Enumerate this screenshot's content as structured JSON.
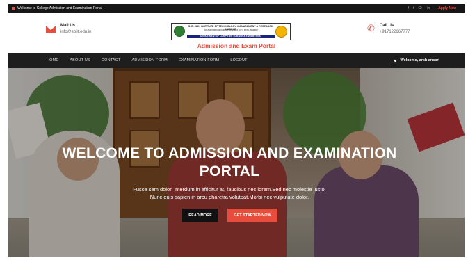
{
  "topbar": {
    "welcome_text": "Welcome to College Admission and Examination Portal",
    "social": [
      "f",
      "t",
      "G+",
      "in"
    ],
    "apply_label": "Apply Now"
  },
  "header": {
    "mail": {
      "label": "Mail Us",
      "value": "info@sbjit.edu.in"
    },
    "call": {
      "label": "Call Us",
      "value": "+917122667777"
    },
    "logo": {
      "line1": "S. B. JAIN INSTITUTE OF TECHNOLOGY, MANAGEMENT & RESEARCH, NAGPUR",
      "line2": "(An Autonomous Institute, Affiliated to RTMNU, Nagpur)",
      "line3": "",
      "line4": "DEPARTMENT OF COMPUTER SCIENCE & ENGINEERING"
    },
    "portal_title": "Admission and Exam Portal"
  },
  "nav": {
    "items": [
      "HOME",
      "ABOUT US",
      "CONTACT",
      "ADMISSION FORM",
      "EXAMINATION FORM",
      "LOGOUT"
    ],
    "user": "Welcome, arsh ansari"
  },
  "hero": {
    "heading_line1": "WELCOME TO ADMISSION AND EXAMINATION",
    "heading_line2": "PORTAL",
    "sub_line1": "Fusce sem dolor, interdum in efficitur at, faucibus nec lorem.Sed nec molestie justo.",
    "sub_line2": "Nunc quis sapien in arcu pharetra volutpat.Morbi nec vulputate dolor.",
    "read_more": "READ MORE",
    "get_started": "GET STARTED NOW"
  },
  "colors": {
    "accent": "#e74c3c",
    "nav_bg": "#1e1e1e",
    "topbar_bg": "#161616"
  }
}
